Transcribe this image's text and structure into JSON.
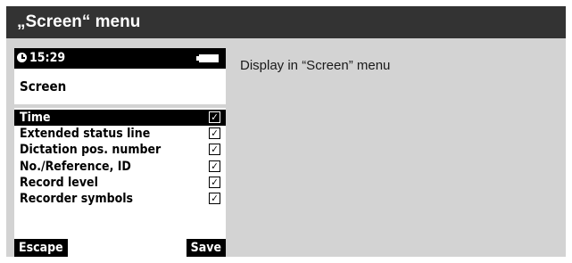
{
  "header": {
    "title": "„Screen“ menu"
  },
  "device": {
    "status": {
      "time": "15:29",
      "clock_icon": "clock-icon",
      "battery_icon": "battery-icon"
    },
    "screen_title": "Screen",
    "options": [
      {
        "label": "Time",
        "checked": true,
        "selected": true
      },
      {
        "label": "Extended status line",
        "checked": true,
        "selected": false
      },
      {
        "label": "Dictation pos. number",
        "checked": true,
        "selected": false
      },
      {
        "label": "No./Reference, ID",
        "checked": true,
        "selected": false
      },
      {
        "label": "Record level",
        "checked": true,
        "selected": false
      },
      {
        "label": "Recorder symbols",
        "checked": true,
        "selected": false
      }
    ],
    "check_mark": "✓",
    "softkeys": {
      "left": "Escape",
      "right": "Save"
    }
  },
  "description": "Display in “Screen” menu",
  "colors": {
    "header_bg": "#333333",
    "panel_bg": "#d3d3d3",
    "device_bg": "#ffffff",
    "ink": "#000000"
  }
}
